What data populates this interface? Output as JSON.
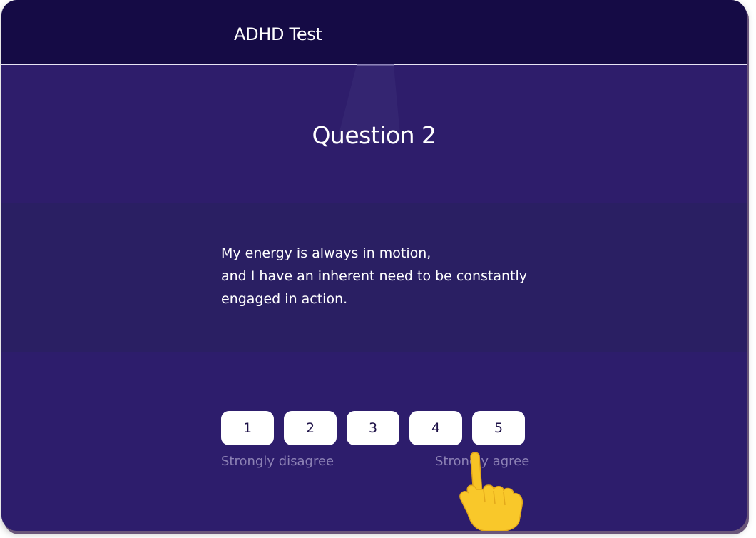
{
  "header": {
    "title": "ADHD Test"
  },
  "question": {
    "heading": "Question 2",
    "lines": [
      "My energy is always in motion,",
      "and I have an inherent need to be constantly",
      "engaged in action."
    ]
  },
  "scale": {
    "options": [
      "1",
      "2",
      "3",
      "4",
      "5"
    ],
    "low_label": "Strongly disagree",
    "high_label": "Strongly agree"
  },
  "colors": {
    "header_bg": "#150b45",
    "page_bg": "#2d1f6a",
    "button_bg": "#ffffff",
    "button_text": "#1d1147",
    "muted_label": "#8d82b5"
  },
  "icons": {
    "pointer": "pointing-hand-icon"
  }
}
